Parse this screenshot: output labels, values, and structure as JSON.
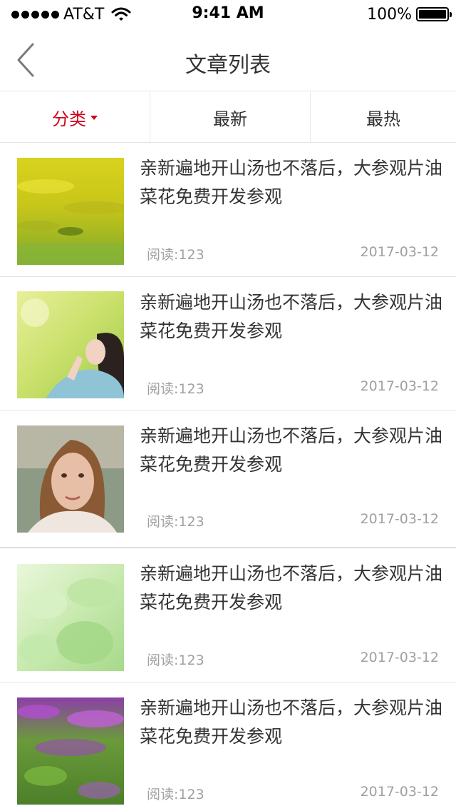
{
  "status_bar": {
    "carrier": "AT&T",
    "time": "9:41 AM",
    "battery": "100%"
  },
  "nav": {
    "title": "文章列表",
    "back_icon": "chevron-left-icon"
  },
  "tabs": [
    {
      "label": "分类",
      "active": true,
      "icon": "caret-down-icon"
    },
    {
      "label": "最新",
      "active": false
    },
    {
      "label": "最热",
      "active": false
    }
  ],
  "colors": {
    "accent": "#d0021b",
    "text": "#333333",
    "meta": "#a0a0a0",
    "divider": "#e3e3e3"
  },
  "articles": [
    {
      "title": "亲新遍地开山汤也不落后，大参观片油菜花免费开发参观",
      "reads": "阅读:123",
      "date": "2017-03-12",
      "thumb": "yellow-flower-field"
    },
    {
      "title": "亲新遍地开山汤也不落后，大参观片油菜花免费开发参观",
      "reads": "阅读:123",
      "date": "2017-03-12",
      "thumb": "girl-looking-up"
    },
    {
      "title": "亲新遍地开山汤也不落后，大参观片油菜花免费开发参观",
      "reads": "阅读:123",
      "date": "2017-03-12",
      "thumb": "woman-portrait"
    },
    {
      "title": "亲新遍地开山汤也不落后，大参观片油菜花免费开发参观",
      "reads": "阅读:123",
      "date": "2017-03-12",
      "thumb": "green-leaves"
    },
    {
      "title": "亲新遍地开山汤也不落后，大参观片油菜花免费开发参观",
      "reads": "阅读:123",
      "date": "2017-03-12",
      "thumb": "lavender-field"
    }
  ]
}
